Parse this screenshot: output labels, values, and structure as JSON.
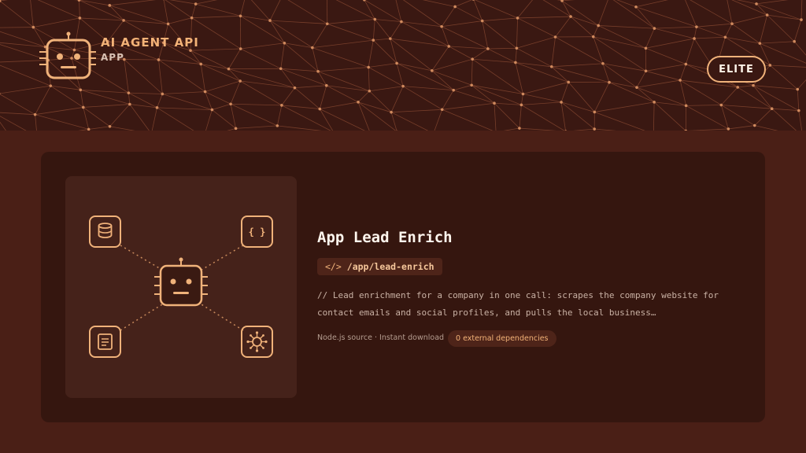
{
  "brand": {
    "title": "AI AGENT API",
    "subtitle": "APP",
    "logo_icon": "robot-icon"
  },
  "tier": {
    "label": "ELITE"
  },
  "app": {
    "title": "App Lead Enrich",
    "route_icon": "code-icon",
    "route_glyph": "</>",
    "route": "/app/lead-enrich",
    "description_line1": "// Lead enrichment for a company in one call: scrapes the company website for",
    "description_line2": "contact emails and social profiles, and pulls the local business…",
    "meta": "Node.js source · Instant download",
    "dependencies": "0 external dependencies"
  },
  "illustration": {
    "center_icon": "robot-icon",
    "nodes": [
      "database-icon",
      "json-braces-icon",
      "document-icon",
      "network-hub-icon"
    ]
  },
  "colors": {
    "accent": "#f0b27a",
    "header_bg": "#3a1812",
    "page_bg": "#4a1f16",
    "card_bg": "#35160f"
  }
}
